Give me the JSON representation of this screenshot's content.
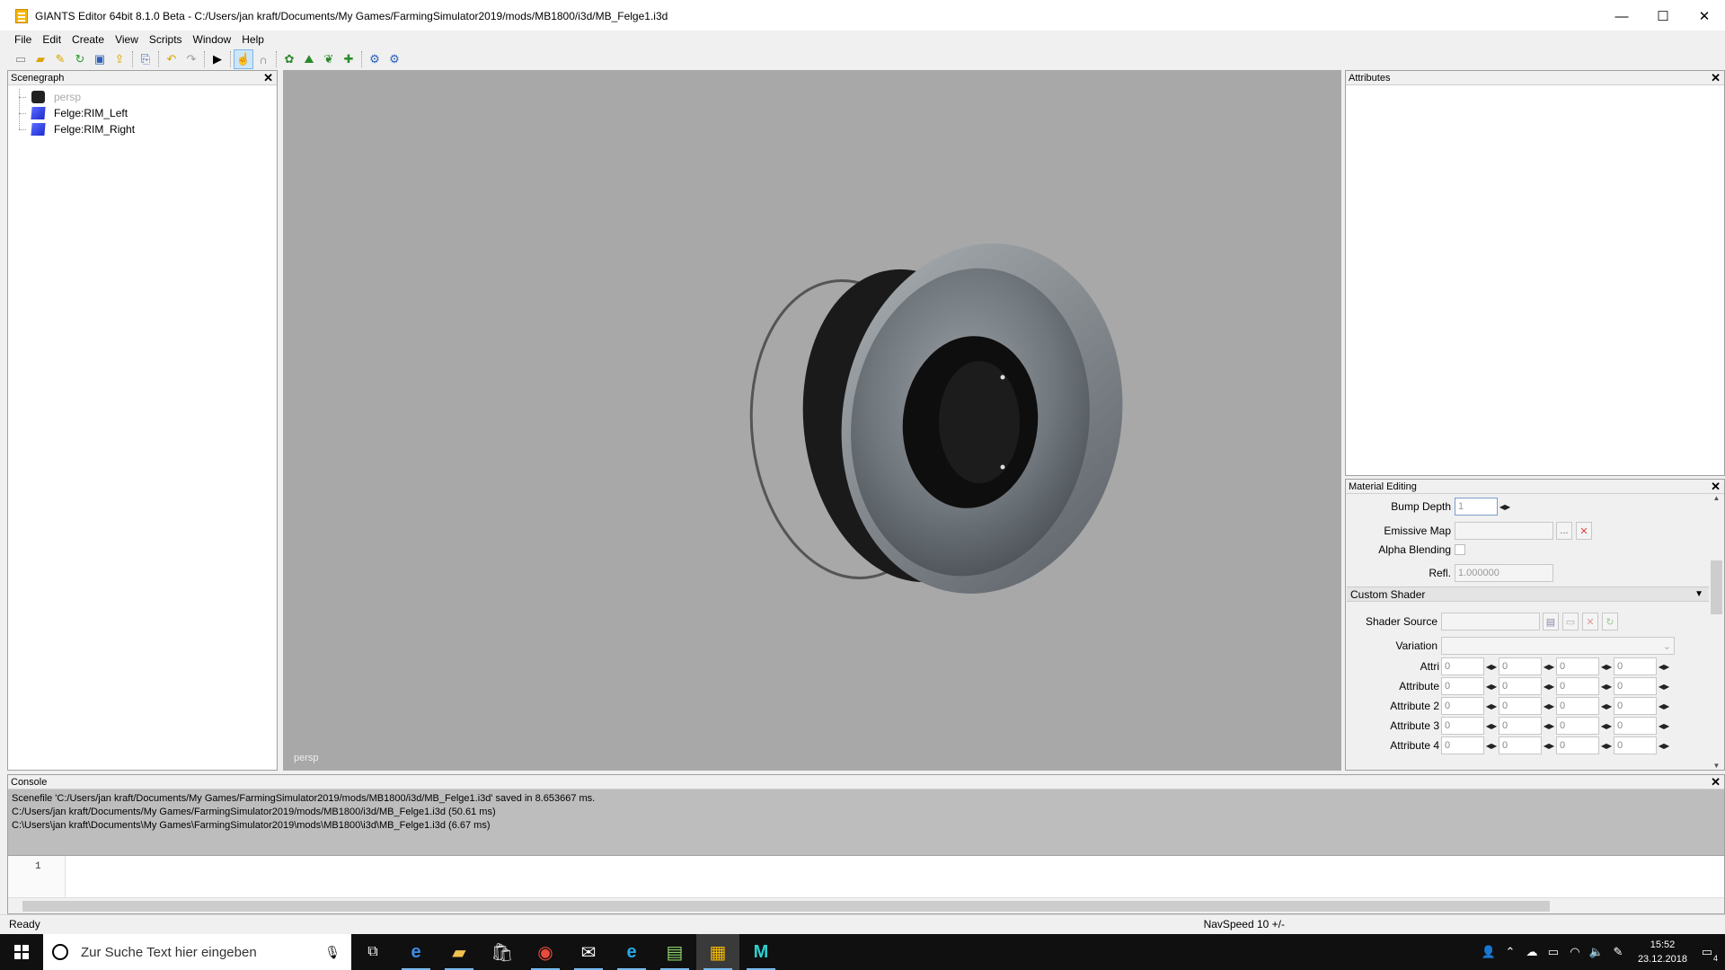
{
  "window": {
    "title": "GIANTS Editor 64bit 8.1.0 Beta - C:/Users/jan kraft/Documents/My Games/FarmingSimulator2019/mods/MB1800/i3d/MB_Felge1.i3d",
    "minimize": "—",
    "maximize": "☐",
    "close": "✕"
  },
  "menu": [
    {
      "label": "File"
    },
    {
      "label": "Edit"
    },
    {
      "label": "Create"
    },
    {
      "label": "View"
    },
    {
      "label": "Scripts"
    },
    {
      "label": "Window"
    },
    {
      "label": "Help"
    }
  ],
  "scenegraph": {
    "title": "Scenegraph",
    "items": [
      {
        "label": "persp",
        "icon": "camera-icon"
      },
      {
        "label": "Felge:RIM_Left",
        "icon": "cube-icon"
      },
      {
        "label": "Felge:RIM_Right",
        "icon": "cube-icon"
      }
    ]
  },
  "viewport": {
    "camera_label": "persp"
  },
  "attributes": {
    "title": "Attributes"
  },
  "material": {
    "title": "Material Editing",
    "bump_depth_label": "Bump Depth",
    "bump_depth_value": "1",
    "emissive_label": "Emissive Map",
    "emissive_browse": "...",
    "alpha_label": "Alpha Blending",
    "refl_label": "Refl.",
    "refl_value": "1.000000",
    "custom_shader": "Custom Shader",
    "shader_source_label": "Shader Source",
    "variation_label": "Variation",
    "attr_rows": [
      {
        "label": "Attri",
        "values": [
          "0",
          "0",
          "0",
          "0"
        ]
      },
      {
        "label": "Attribute",
        "values": [
          "0",
          "0",
          "0",
          "0"
        ]
      },
      {
        "label": "Attribute 2",
        "values": [
          "0",
          "0",
          "0",
          "0"
        ]
      },
      {
        "label": "Attribute 3",
        "values": [
          "0",
          "0",
          "0",
          "0"
        ]
      },
      {
        "label": "Attribute 4",
        "values": [
          "0",
          "0",
          "0",
          "0"
        ]
      }
    ]
  },
  "console": {
    "title": "Console",
    "lines": [
      "Scenefile 'C:/Users/jan kraft/Documents/My Games/FarmingSimulator2019/mods/MB1800/i3d/MB_Felge1.i3d' saved in 8.653667 ms.",
      "C:/Users/jan kraft/Documents/My Games/FarmingSimulator2019/mods/MB1800/i3d/MB_Felge1.i3d (50.61 ms)",
      "C:\\Users\\jan kraft\\Documents\\My Games\\FarmingSimulator2019\\mods\\MB1800\\i3d\\MB_Felge1.i3d (6.67 ms)"
    ],
    "line_number": "1"
  },
  "status": {
    "left": "Ready",
    "right": "NavSpeed 10 +/-"
  },
  "taskbar": {
    "search_placeholder": "Zur Suche Text hier eingeben",
    "time": "15:52",
    "date": "23.12.2018",
    "notification_count": "4"
  },
  "colors": {
    "accent": "#76b9ed",
    "viewport_bg": "#a8a8a8"
  }
}
